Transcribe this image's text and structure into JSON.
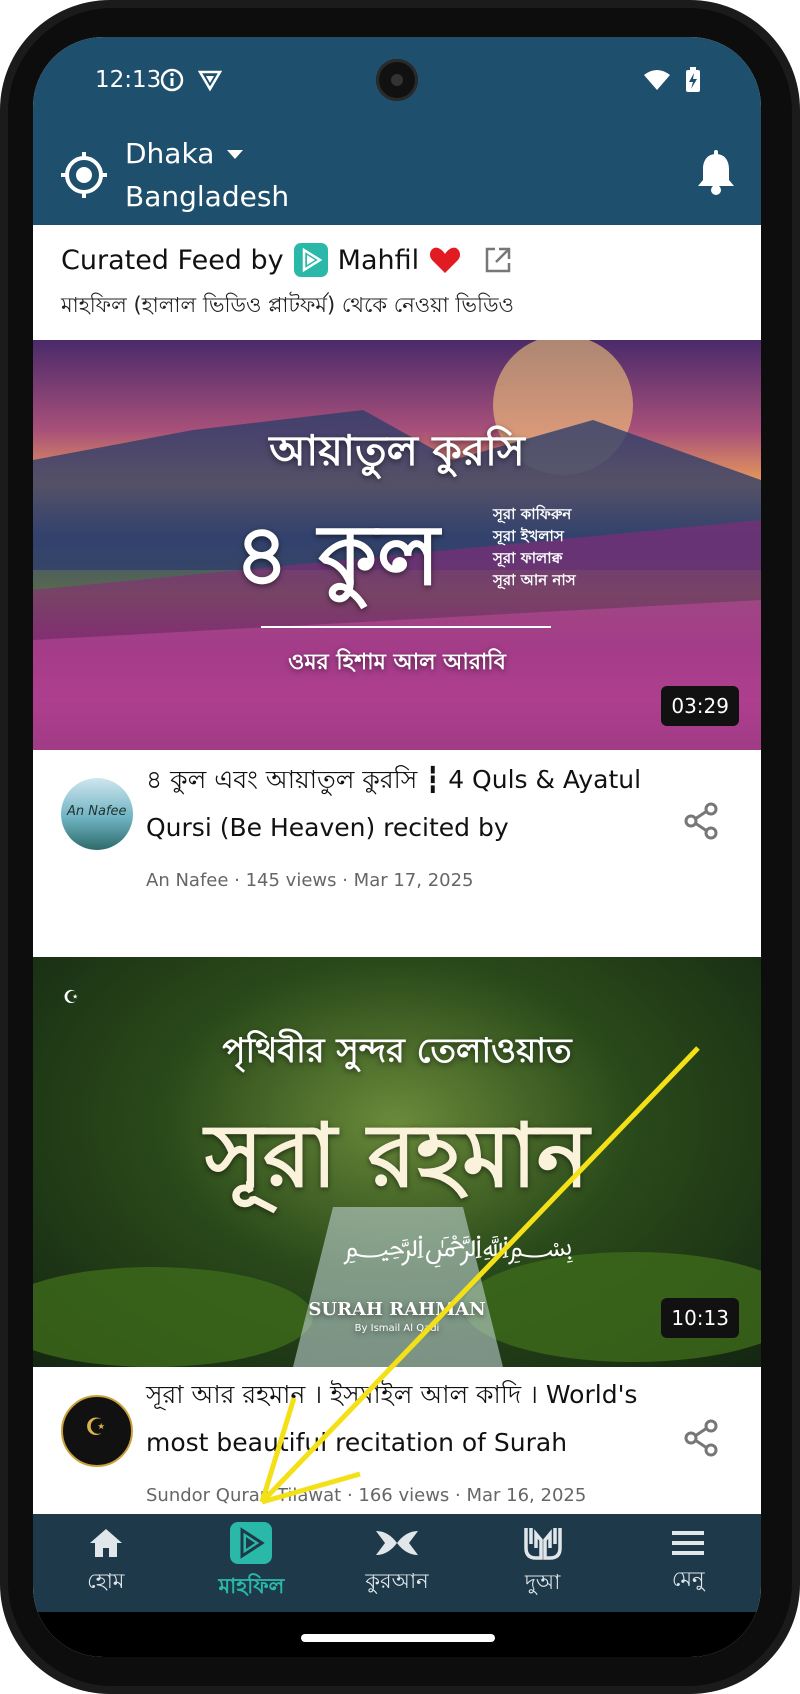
{
  "status_bar": {
    "time": "12:13"
  },
  "header": {
    "city": "Dhaka",
    "country": "Bangladesh"
  },
  "feed": {
    "title_prefix": "Curated Feed by",
    "brand": "Mahfil",
    "subtitle": "মাহফিল (হালাল ভিডিও প্লাটফর্ম) থেকে নেওয়া ভিডিও"
  },
  "videos": [
    {
      "thumb_title": "আয়াতুল কুরসি",
      "thumb_big": "৪ কুল",
      "thumb_side": [
        "সূরা কাফিরুন",
        "সূরা ইখলাস",
        "সূরা ফালাক্ব",
        "সূরা আন নাস"
      ],
      "thumb_footer": "ওমর হিশাম আল আরাবি",
      "duration": "03:29",
      "avatar_text": "An Nafee",
      "title": "৪ কুল এবং আয়াতুল কুরসি ┇ 4 Quls & Ayatul Qursi (Be Heaven) recited by",
      "meta": "An Nafee · 145 views · Mar 17, 2025"
    },
    {
      "thumb_title": "পৃথিবীর সুন্দর তেলাওয়াত",
      "thumb_big": "সূরা রহমান",
      "thumb_footer": "SURAH RAHMAN",
      "thumb_footer2": "By Ismail Al Qadi",
      "duration": "10:13",
      "title": "সূরা আর রহমান । ইসমাইল আল কাদি । World's most beautiful recitation of Surah",
      "meta": "Sundor Quran Tilawat · 166 views · Mar 16, 2025"
    }
  ],
  "bottom_nav": [
    {
      "label": "হোম",
      "icon": "home-icon"
    },
    {
      "label": "মাহফিল",
      "icon": "play-icon",
      "active": true
    },
    {
      "label": "কুরআন",
      "icon": "quran-icon"
    },
    {
      "label": "দুআ",
      "icon": "dua-hands-icon"
    },
    {
      "label": "মেনু",
      "icon": "menu-icon"
    }
  ],
  "colors": {
    "header": "#1e4f6c",
    "nav": "#1e3a4a",
    "accent": "#2ab8a8",
    "arrow": "#f4e017"
  }
}
